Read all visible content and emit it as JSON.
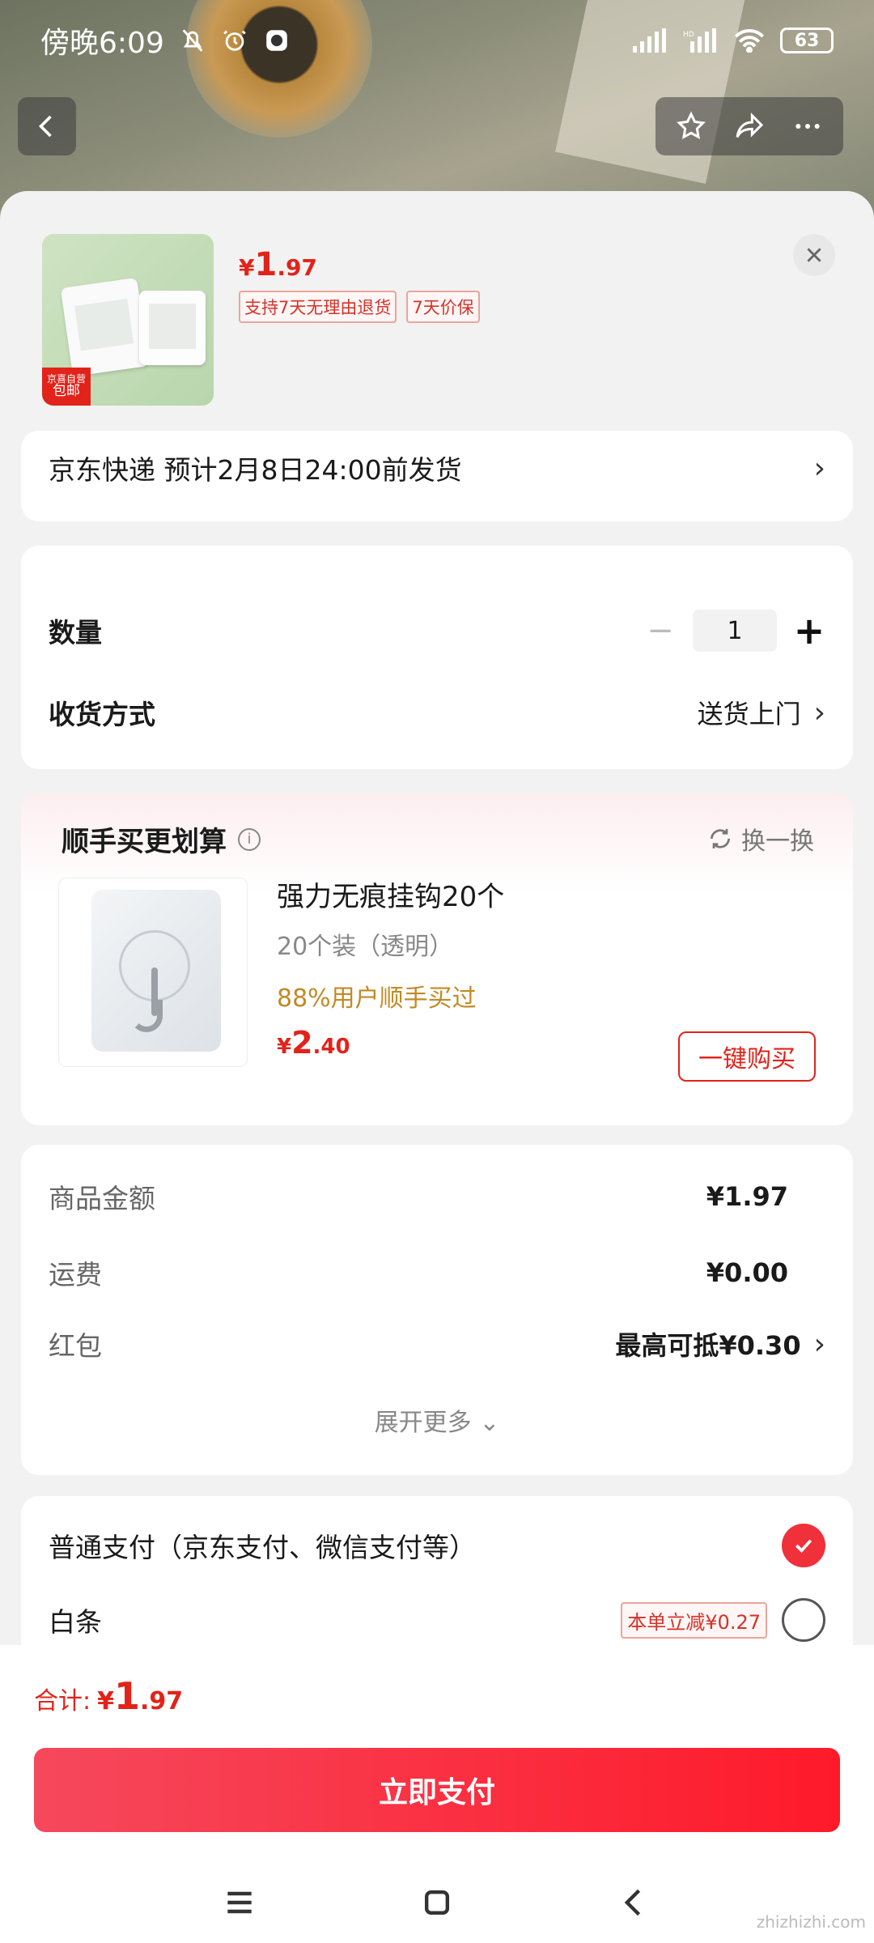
{
  "status_bar": {
    "time": "傍晚6:09",
    "battery": "63"
  },
  "product": {
    "price_yen": "¥",
    "price_int": "1",
    "price_dec": ".97",
    "tags": [
      "支持7天无理由退货",
      "7天价保"
    ],
    "badge_top": "京喜自营",
    "badge_bottom": "包邮"
  },
  "delivery": {
    "text": "京东快递 预计2月8日24:00前发货"
  },
  "quantity": {
    "label": "数量",
    "value": "1"
  },
  "receive": {
    "label": "收货方式",
    "value": "送货上门"
  },
  "recommend": {
    "title": "顺手买更划算",
    "refresh": "换一换",
    "name": "强力无痕挂钩20个",
    "spec": "20个装（透明）",
    "hint": "88%用户顺手买过",
    "price_yen": "¥",
    "price_int": "2",
    "price_dec": ".40",
    "buy_label": "一键购买"
  },
  "fees": {
    "goods_label": "商品金额",
    "goods_value": "¥1.97",
    "shipping_label": "运费",
    "shipping_value": "¥0.00",
    "redpacket_label": "红包",
    "redpacket_value": "最高可抵¥0.30",
    "expand": "展开更多"
  },
  "payment": {
    "normal_label": "普通支付（京东支付、微信支付等）",
    "baitiao_label": "白条",
    "baitiao_promo": "本单立减¥0.27"
  },
  "bottom": {
    "total_label": "合计:",
    "total_yen": "¥",
    "total_int": "1",
    "total_dec": ".97",
    "pay_label": "立即支付"
  },
  "watermark": "zhizhizhi.com",
  "colors": {
    "accent": "#e2231a",
    "pay_gradient_start": "#f6485c",
    "pay_gradient_end": "#fe1a2a"
  }
}
